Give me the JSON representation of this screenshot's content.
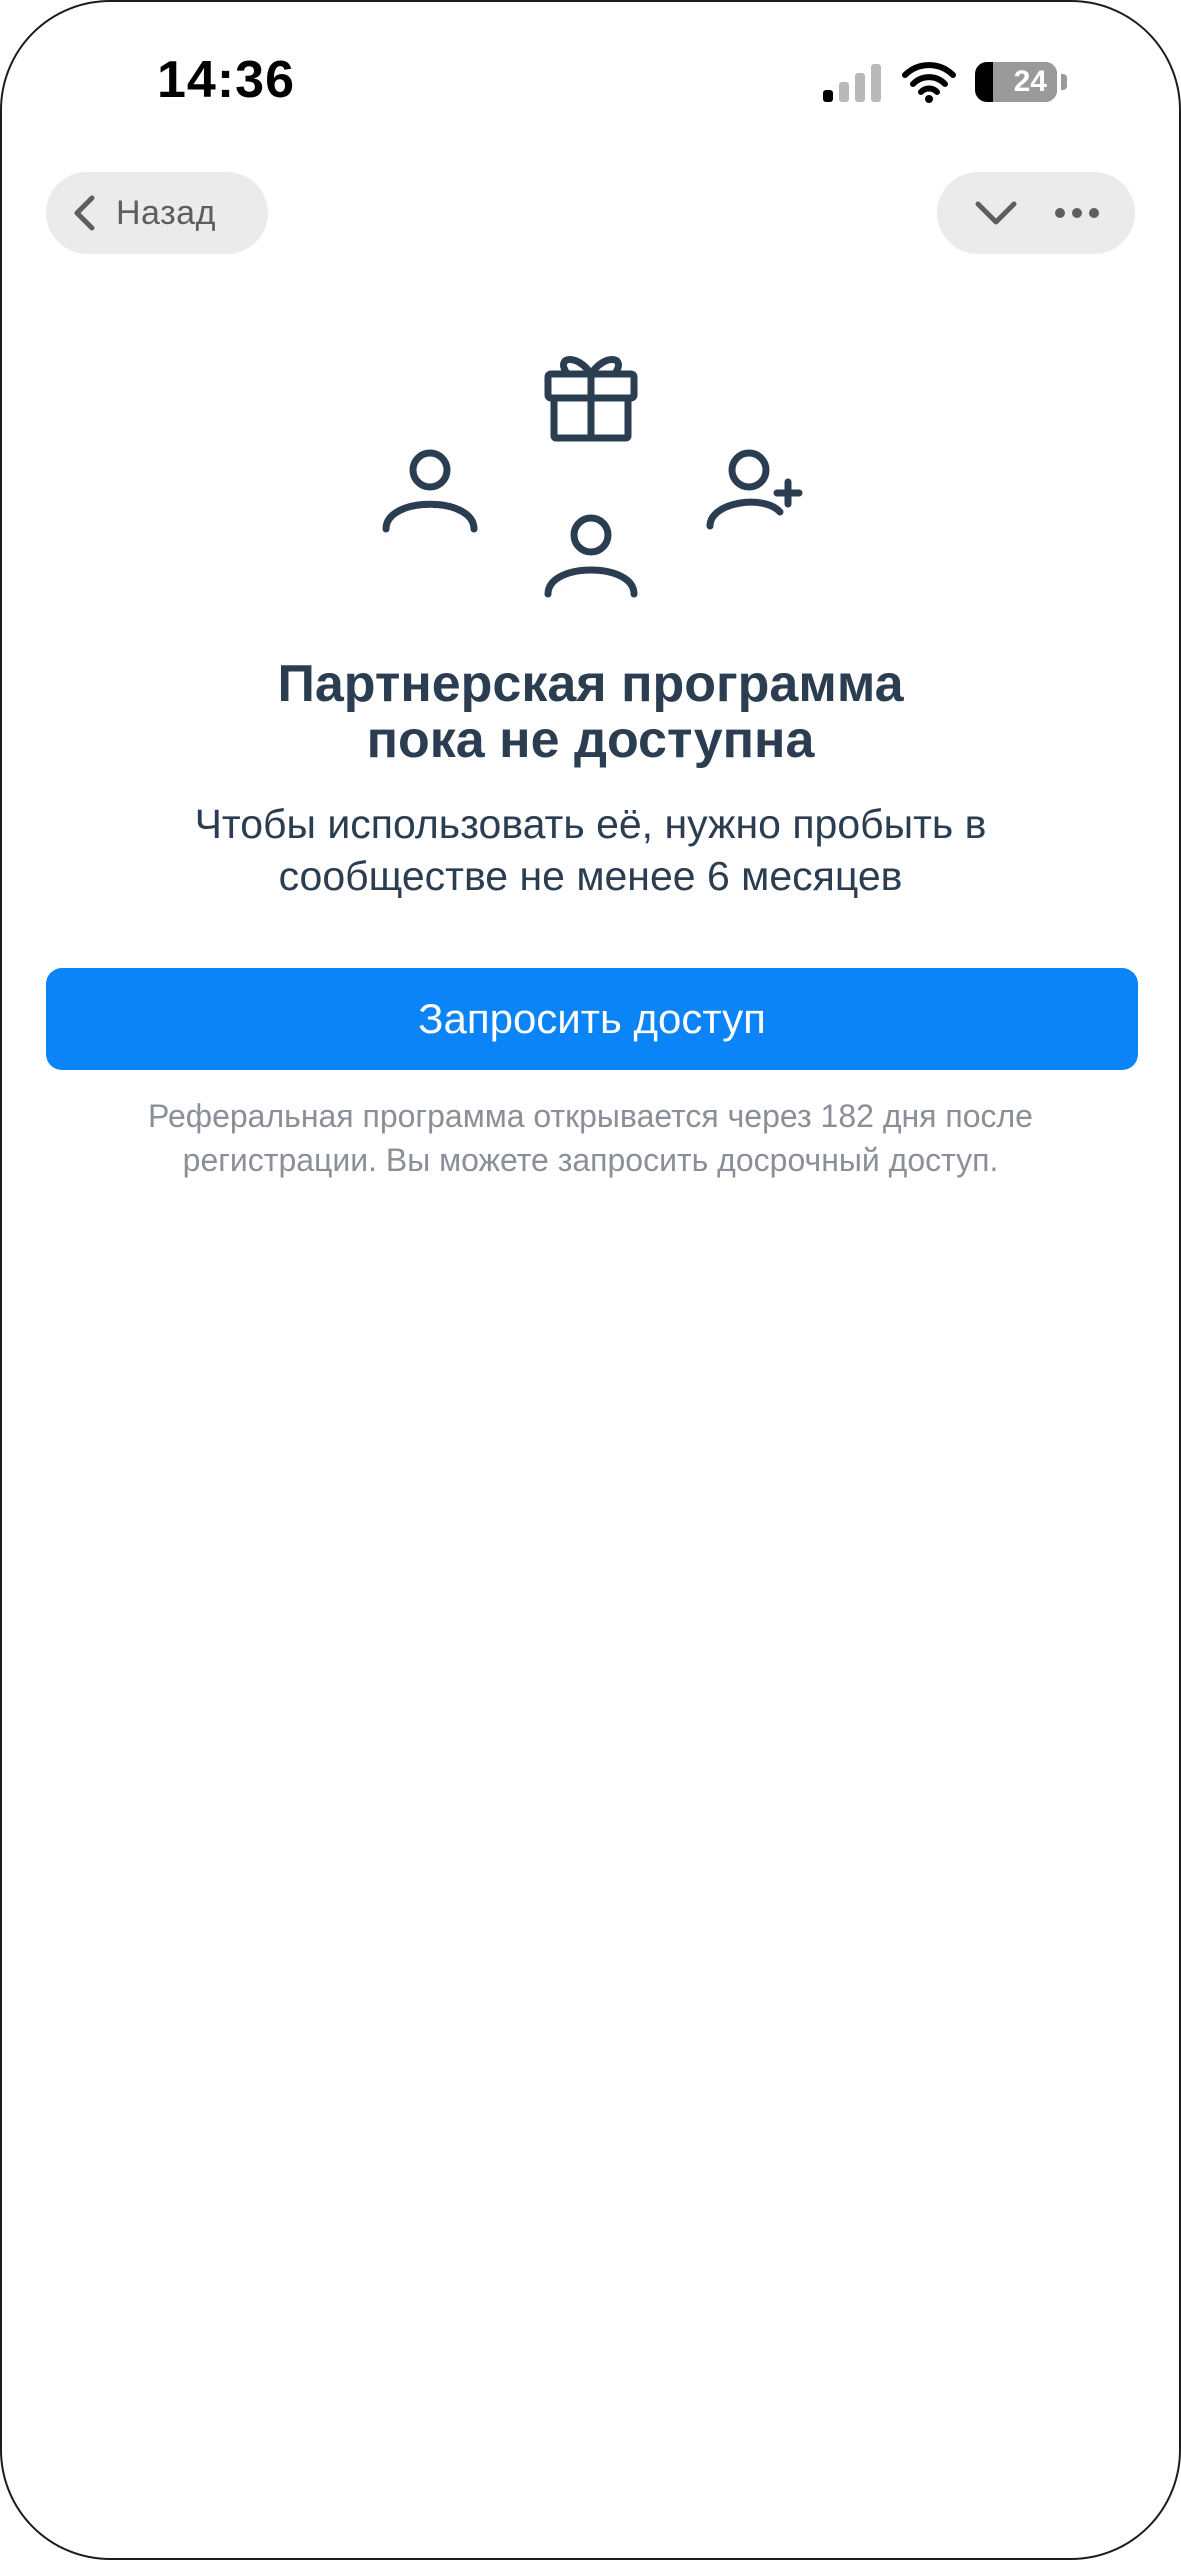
{
  "status_bar": {
    "time": "14:36",
    "battery_level": "24"
  },
  "nav": {
    "back_label": "Назад"
  },
  "content": {
    "title_line1": "Партнерская программа",
    "title_line2": "пока не доступна",
    "subtitle_line1": "Чтобы использовать её, нужно пробыть в",
    "subtitle_line2": "сообществе не менее 6 месяцев",
    "cta_label": "Запросить доступ",
    "footnote_line1": "Реферальная программа открывается через 182 дня после",
    "footnote_line2": "регистрации. Вы можете запросить досрочный доступ."
  },
  "colors": {
    "accent": "#0a84f7",
    "text_primary": "#2b3d50",
    "text_secondary": "#8a8f98",
    "pill_bg": "#ebebeb"
  },
  "icons": {
    "back": "chevron-left-icon",
    "collapse": "chevron-down-icon",
    "menu": "more-horizontal-icon",
    "illustration": [
      "gift-icon",
      "user-icon",
      "user-icon",
      "user-plus-icon"
    ]
  }
}
